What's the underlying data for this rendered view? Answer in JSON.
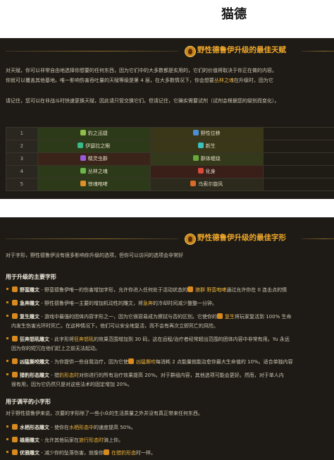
{
  "page_title": "猫德",
  "talents": {
    "heading": "野性德鲁伊升级的最佳天赋",
    "intro_lines": [
      "对天赋，你可以非常自由地选择你想要的任何东西，因为它们中的大多数都是实用的，它们的价值将取决于你正在做的内容。",
      "你就可以覆盖其他基地。唯一影响伤害吞吐量的天赋等级是第 4 层，在大多数情况下，你会想要丛林之魂在升级时，因为它"
    ],
    "intro_highlight": "丛林之魂",
    "note": "请记住，您可以在非战斗时快速更换天赋，因此请只管交换它们。但请记住，它确实需要试剂（试剂会根据您的级别而变化）。",
    "rows": [
      {
        "level": "1",
        "c1": "豹之迅捷",
        "c2": "野性位移"
      },
      {
        "level": "2",
        "c1": "伊瑟拉之眼",
        "c2": "新生"
      },
      {
        "level": "3",
        "c1": "精灵虫群",
        "c2": "群体缠绕"
      },
      {
        "level": "4",
        "c1": "丛林之魂",
        "c2": "化身"
      },
      {
        "level": "5",
        "c1": "惊魂咆哮",
        "c2": "乌索尔旋风"
      }
    ]
  },
  "glyphs": {
    "heading": "野性德鲁伊升级的最佳字形",
    "intro": "对于字形，野性德鲁伊没有很多影响你升级的选项，但你可以访问的选项会非常好",
    "major_heading": "用于升级的主要字形",
    "major_items": [
      {
        "name": "野蛮雕文",
        "text": " - 野蛮德鲁伊唯一的伤害增加字形，允许你进入任何处于活动状态的",
        "hl": "狼群 野蛮咆哮",
        "tail": "通过允许你在 0 连击点的情"
      },
      {
        "name": "急奔雕文",
        "text": " - 野性德鲁伊唯一主要的增加机动性的雕文，将",
        "hl": "急奔",
        "tail": "的冷却时间减少整整一分钟。"
      },
      {
        "name": "复生雕文",
        "text": " - 游戏中最强的团体内容字形之一，因为它很容易成为擦拭与否的区别。它使你的",
        "hl": "复生",
        "tail": "将玩家复活到 100% 生命"
      },
      {
        "name": "狂奔怒吼雕文",
        "text": " - 此字形将",
        "hl": "狂奔怒吼",
        "tail": "的效果范围增加到 30 码，这在远程/治疗者经常超出范围的团体内容中非常有用。Yu 永远"
      },
      {
        "name": "凶猛撕咬雕文",
        "text": " - 为你提供一些自我治疗，因为它使",
        "hl": "凶猛撕咬",
        "tail": "每消耗 2 点能量就能治愈你最大生命值的 10%。适合单独内容"
      },
      {
        "name": "猎豹形态雕文",
        "text": " - 猎",
        "hl": "豹形态时",
        "tail": "对你进行的所有治疗效果提高 20%。对于群组内容，其他选项可能会更好。然而，对于单人内"
      }
    ],
    "major_continuations": {
      "2": "内发生伤害光环时死亡。在这种情况下，他们可以安全地复活，而不会有再次立即死亡的风险。",
      "3": "因为你的短冗在他们赶上之前无法起动。",
      "5": "很有用，因为它仍然只是对这些法术的固定增加 20%。"
    },
    "minor_heading": "用于调平的小字形",
    "minor_intro": "对于野性德鲁伊来说，次要的字形除了一些小众的生活质量之外并没有真正带来任何东西。",
    "minor_items": [
      {
        "name": "水栖形态雕文",
        "text": " - 使你在",
        "hl": "水栖形态中",
        "tail": "的速度提高 50%。"
      },
      {
        "name": "雄鹿雕文",
        "text": " - 允许其他玩家在",
        "hl": "旅行形态时",
        "tail": "骑上你。"
      },
      {
        "name": "优雅雕文",
        "text": " - 减少你的坠落伤害，就像你",
        "hl": "在猎豹形态",
        "tail": "时一样。"
      }
    ]
  },
  "colors": {
    "panel_bg": "#1e1b16",
    "accent": "#f0a82a",
    "highlight": "#f0b43a"
  }
}
